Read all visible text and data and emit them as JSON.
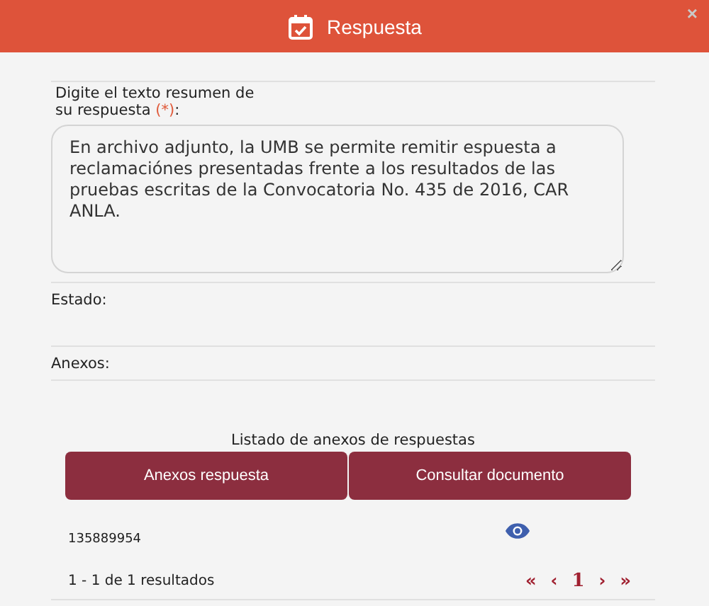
{
  "window": {
    "title": "Respuesta",
    "close": "×"
  },
  "summary": {
    "label": "Digite el texto resumen de su respuesta",
    "required_mark": "(*)",
    "colon": ":",
    "value": "En archivo adjunto, la UMB se permite remitir espuesta a reclamaciónes presentadas frente a los resultados de las pruebas escritas de la Convocatoria No. 435 de 2016, CAR ANLA."
  },
  "fields": [
    {
      "label": "Estado:"
    },
    {
      "label": "Anexos:"
    }
  ],
  "table": {
    "title": "Listado de anexos de respuestas",
    "columns": [
      "Anexos respuesta",
      "Consultar documento"
    ],
    "rows": [
      {
        "cell": "135889954"
      }
    ],
    "summary": "1 - 1 de 1 resultados",
    "pager": [
      {
        "text": "«",
        "kind": "nav"
      },
      {
        "text": "‹",
        "kind": "nav"
      },
      {
        "text": "1",
        "kind": "page"
      },
      {
        "text": "›",
        "kind": "nav"
      },
      {
        "text": "»",
        "kind": "nav"
      }
    ]
  }
}
